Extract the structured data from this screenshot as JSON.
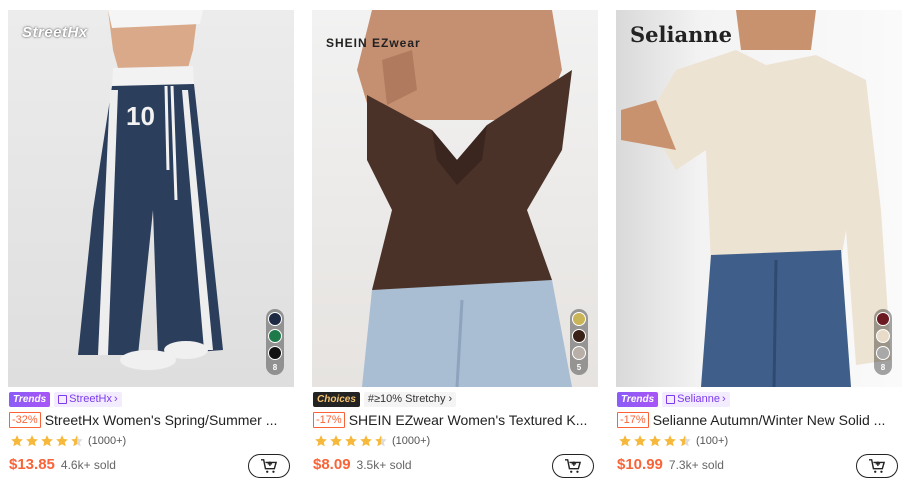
{
  "products": [
    {
      "brand_logo": "StreetHx",
      "badge": "Trends",
      "store": "StreetHx",
      "discount": "-32%",
      "title": "StreetHx Women's Spring/Summer ...",
      "rating": 4.5,
      "review_count": "(1000+)",
      "price": "$13.85",
      "sold": "4.6k+ sold",
      "swatch_colors": [
        "#1e2a44",
        "#1f7a4a",
        "#111111"
      ],
      "swatch_count": "8"
    },
    {
      "brand_logo": "SHEIN EZwear",
      "badge": "Choices",
      "attribute": "#≥10% Stretchy",
      "discount": "-17%",
      "title": "SHEIN EZwear Women's Textured K...",
      "rating": 4.5,
      "review_count": "(1000+)",
      "price": "$8.09",
      "sold": "3.5k+ sold",
      "swatch_colors": [
        "#c9b458",
        "#3a2218",
        "#b8b0a8"
      ],
      "swatch_count": "5"
    },
    {
      "brand_logo": "Selianne",
      "badge": "Trends",
      "store": "Selianne",
      "discount": "-17%",
      "title": "Selianne Autumn/Winter New Solid ...",
      "rating": 4.5,
      "review_count": "(100+)",
      "price": "$10.99",
      "sold": "7.3k+ sold",
      "swatch_colors": [
        "#6b1a22",
        "#e8dcc8",
        "#a8a8a8"
      ],
      "swatch_count": "8"
    }
  ],
  "colors": {
    "accent": "#fa6338",
    "trends": "#8b5cf6",
    "star": "#f6b93b"
  }
}
